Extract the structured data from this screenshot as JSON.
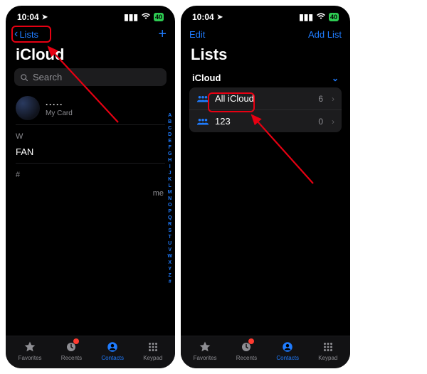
{
  "status": {
    "time": "10:04",
    "battery": "40"
  },
  "left": {
    "back_label": "Lists",
    "title": "iCloud",
    "search_placeholder": "Search",
    "me": {
      "name_mask": "·····",
      "sub": "My Card"
    },
    "sections": [
      {
        "letter": "W",
        "items": [
          "FAN"
        ]
      },
      {
        "letter": "#",
        "items": []
      }
    ],
    "index": [
      "A",
      "B",
      "C",
      "D",
      "E",
      "F",
      "G",
      "H",
      "I",
      "J",
      "K",
      "L",
      "M",
      "N",
      "O",
      "P",
      "Q",
      "R",
      "S",
      "T",
      "U",
      "V",
      "W",
      "X",
      "Y",
      "Z",
      "#"
    ],
    "me_pill": "me"
  },
  "right": {
    "edit_label": "Edit",
    "add_label": "Add List",
    "title": "Lists",
    "account": "iCloud",
    "rows": [
      {
        "name": "All iCloud",
        "count": "6"
      },
      {
        "name": "123",
        "count": "0"
      }
    ]
  },
  "tabs": {
    "favorites": "Favorites",
    "recents": "Recents",
    "contacts": "Contacts",
    "keypad": "Keypad"
  }
}
